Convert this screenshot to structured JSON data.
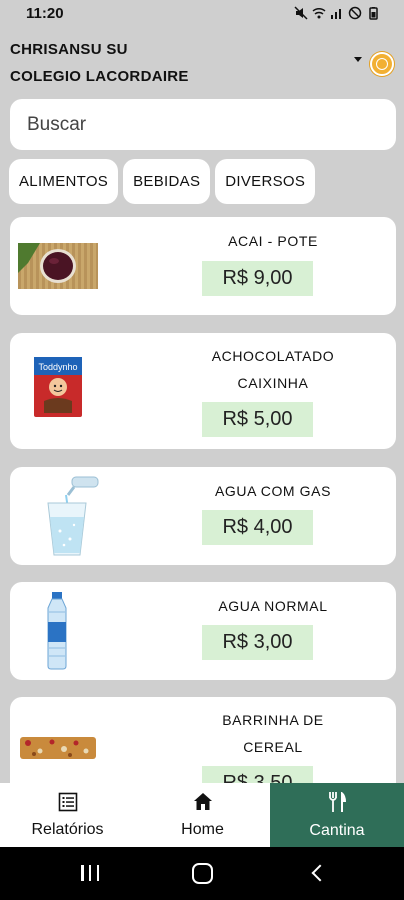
{
  "status_bar": {
    "time": "11:20"
  },
  "header": {
    "user_name": "CHRISANSU SU",
    "school_name": "COLEGIO LACORDAIRE"
  },
  "search": {
    "placeholder": "Buscar"
  },
  "categories": [
    "ALIMENTOS",
    "BEBIDAS",
    "DIVERSOS"
  ],
  "products": [
    {
      "name": "ACAI - POTE",
      "price": "R$ 9,00",
      "icon": "acai-bowl-image"
    },
    {
      "name": "ACHOCOLATADO CAIXINHA",
      "name_line1": "ACHOCOLATADO",
      "name_line2": "CAIXINHA",
      "price": "R$ 5,00",
      "icon": "chocolate-milk-box-image"
    },
    {
      "name": "AGUA COM GAS",
      "price": "R$ 4,00",
      "icon": "sparkling-water-glass-image"
    },
    {
      "name": "AGUA NORMAL",
      "price": "R$ 3,00",
      "icon": "water-bottle-image"
    },
    {
      "name": "BARRINHA DE CEREAL",
      "name_line1": "BARRINHA DE",
      "name_line2": "CEREAL",
      "price": "R$ 3,50",
      "icon": "cereal-bar-image"
    }
  ],
  "bottom_nav": {
    "tabs": [
      {
        "label": "Relatórios",
        "icon": "report-list-icon",
        "active": false
      },
      {
        "label": "Home",
        "icon": "home-icon",
        "active": false
      },
      {
        "label": "Cantina",
        "icon": "fork-knife-icon",
        "active": true
      }
    ]
  },
  "colors": {
    "accent": "#2f6e58",
    "price_bg": "#d8f0d4",
    "background": "#cfcfcf"
  }
}
